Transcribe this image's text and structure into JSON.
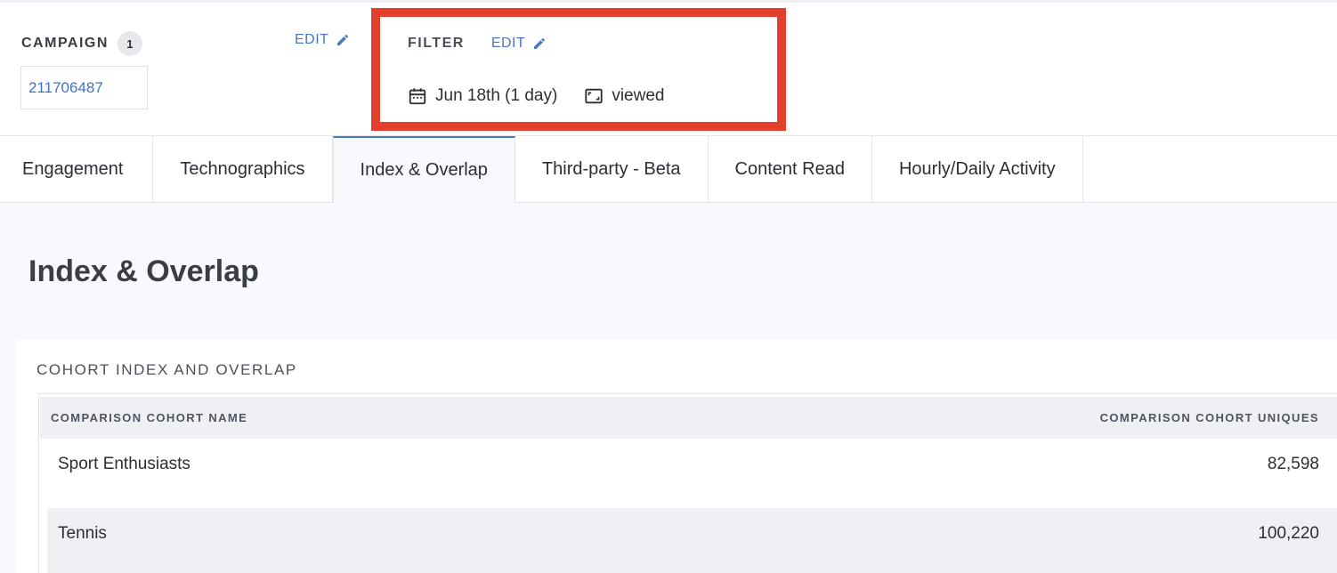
{
  "header": {
    "campaign_label": "CAMPAIGN",
    "campaign_count": "1",
    "campaign_id": "211706487",
    "campaign_edit_label": "EDIT",
    "filter_label": "FILTER",
    "filter_edit_label": "EDIT",
    "filter_date": "Jun 18th (1 day)",
    "filter_event": "viewed",
    "highlight_color": "#e2402c",
    "accent_color": "#4a78c2"
  },
  "icons": {
    "edit": "pencil-icon",
    "date": "calendar-icon",
    "event": "viewed-frame-icon"
  },
  "tabs": [
    {
      "label": "Engagement",
      "active": false
    },
    {
      "label": "Technographics",
      "active": false
    },
    {
      "label": "Index & Overlap",
      "active": true
    },
    {
      "label": "Third-party - Beta",
      "active": false
    },
    {
      "label": "Content Read",
      "active": false
    },
    {
      "label": "Hourly/Daily Activity",
      "active": false
    }
  ],
  "main": {
    "page_title": "Index & Overlap",
    "card_title": "COHORT INDEX AND OVERLAP",
    "table": {
      "columns": [
        "COMPARISON COHORT NAME",
        "COMPARISON COHORT UNIQUES"
      ],
      "rows": [
        {
          "name": "Sport Enthusiasts",
          "uniques": "82,598"
        },
        {
          "name": "Tennis",
          "uniques": "100,220"
        }
      ]
    }
  }
}
